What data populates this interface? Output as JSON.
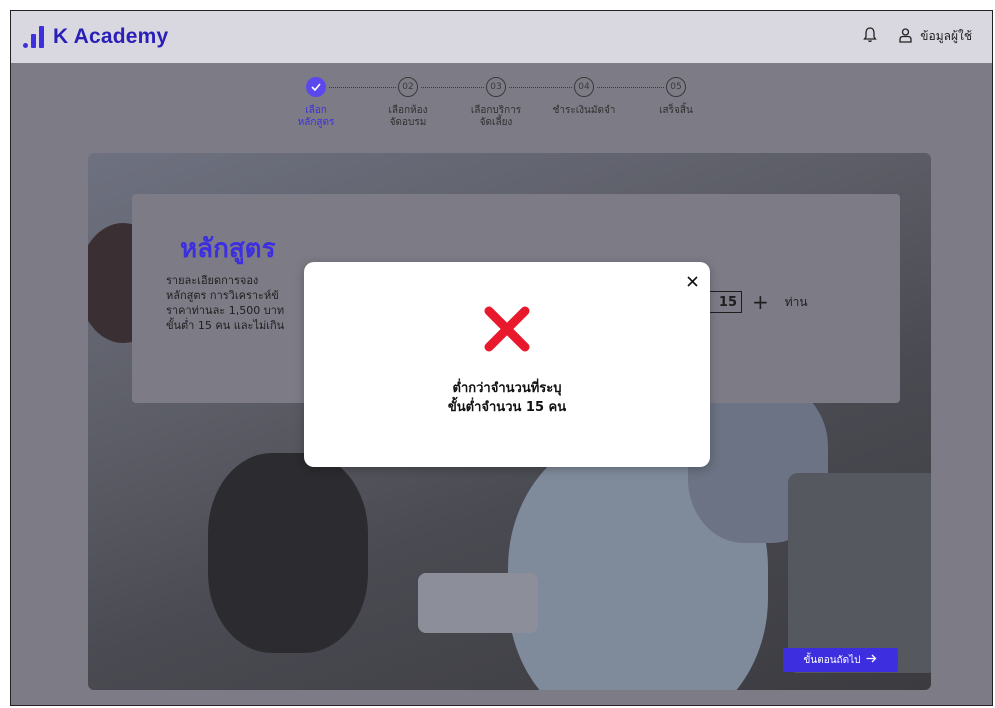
{
  "header": {
    "logo_text": "K Academy",
    "user_label": "ข้อมูลผู้ใช้",
    "icons": {
      "notifications": "bell-icon",
      "user": "user-icon"
    }
  },
  "stepper": {
    "steps": [
      {
        "number": "",
        "label": "เลือกหลักสูตร",
        "state": "done"
      },
      {
        "number": "02",
        "label": "เลือกห้องจัดอบรม",
        "state": "pending"
      },
      {
        "number": "03",
        "label": "เลือกบริการจัดเลี้ยง",
        "state": "pending"
      },
      {
        "number": "04",
        "label": "ชำระเงินมัดจำ",
        "state": "pending"
      },
      {
        "number": "05",
        "label": "เสร็จสิ้น",
        "state": "pending"
      }
    ]
  },
  "course": {
    "title": "หลักสูตร",
    "lines": [
      "รายละเอียดการจอง",
      "หลักสูตร การวิเคราะห์ข้",
      "ราคาท่านละ 1,500 บาท",
      "ขั้นต่ำ 15 คน และไม่เกิน"
    ],
    "quantity": "15",
    "quantity_unit": "ท่าน"
  },
  "next_button": {
    "label": "ขั้นตอนถัดไป",
    "icon": "arrow-right-icon"
  },
  "modal": {
    "message_line1": "ต่ำกว่าจำนวนที่ระบุ",
    "message_line2": "ขั้นต่ำจำนวน 15 คน",
    "close_icon": "close-icon",
    "error_icon": "error-x-icon"
  },
  "colors": {
    "brand": "#3d2ee0",
    "error": "#e8192c",
    "header_bg": "#d9d8e0"
  }
}
